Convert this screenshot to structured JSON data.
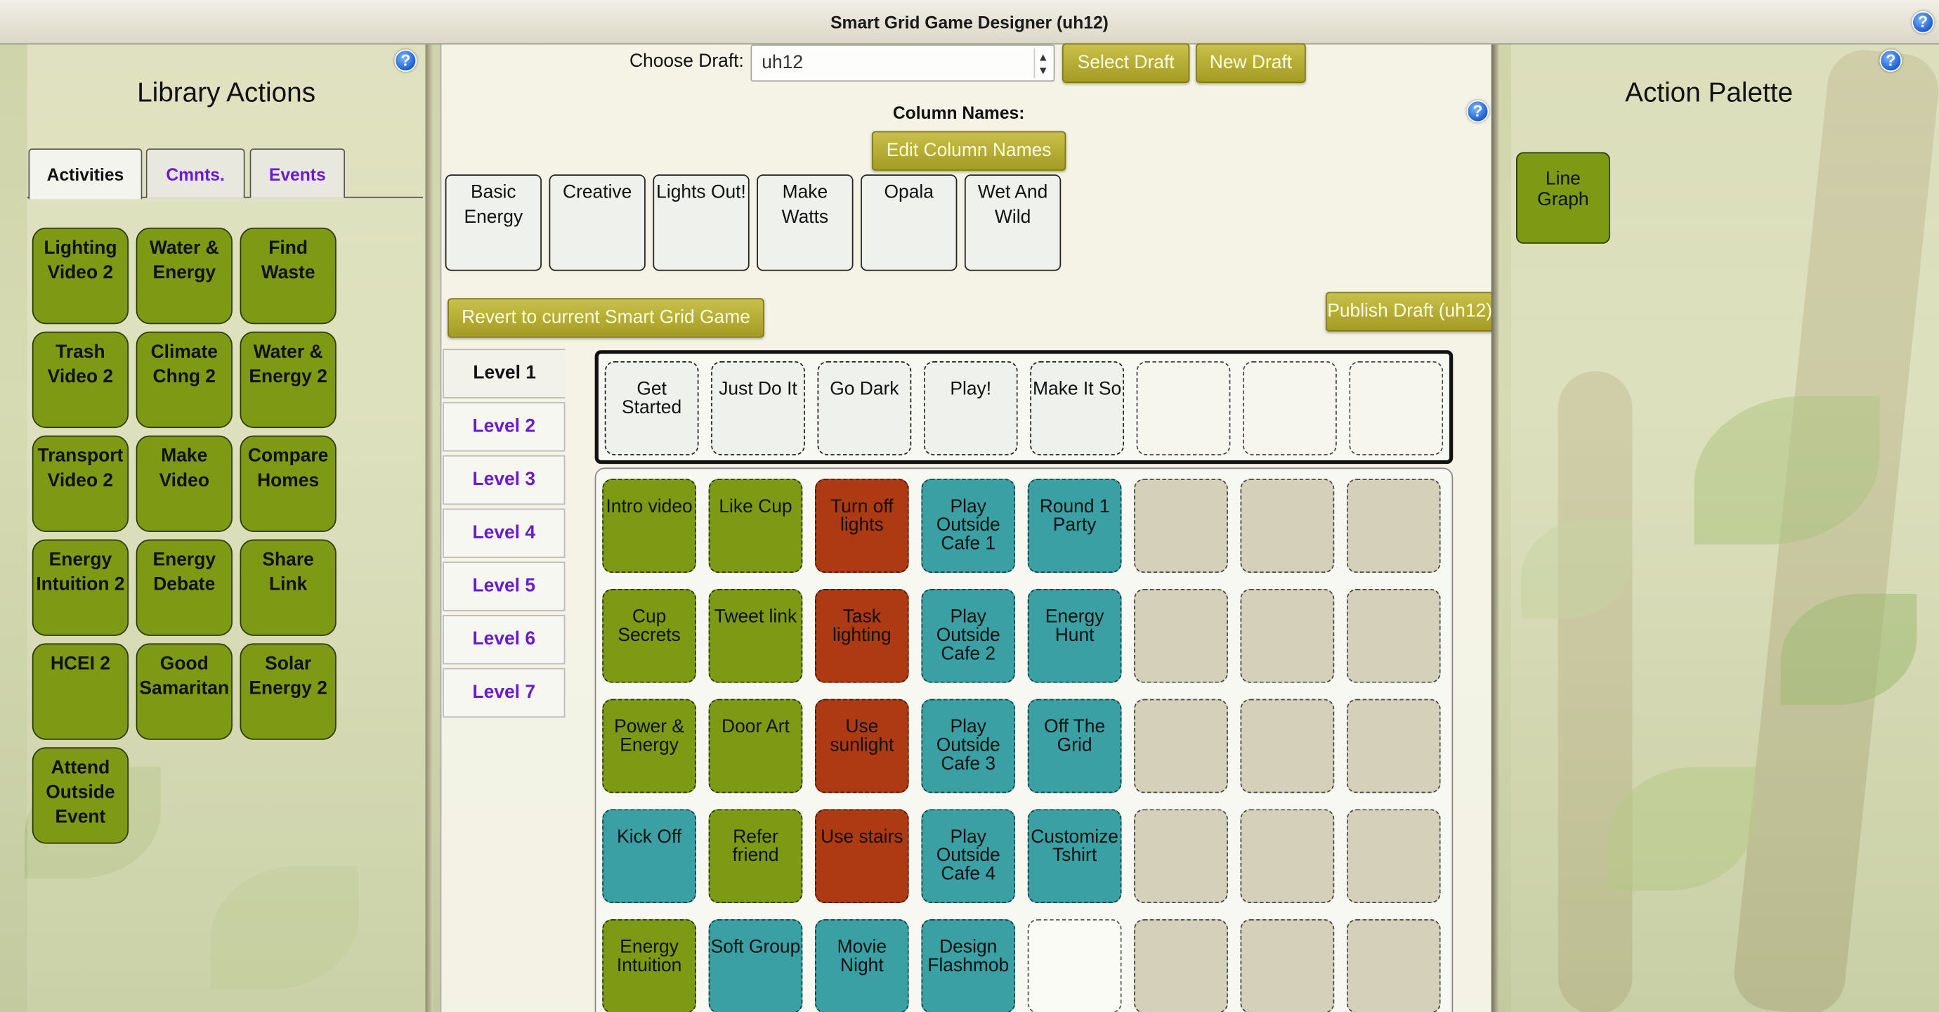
{
  "window": {
    "title": "Smart Grid Game Designer (uh12)"
  },
  "help_icon_glyph": "?",
  "library": {
    "title": "Library Actions",
    "tabs": [
      "Activities",
      "Cmnts.",
      "Events"
    ],
    "buttons": [
      "Lighting Video 2",
      "Water & Energy",
      "Find Waste",
      "Trash Video 2",
      "Climate Chng 2",
      "Water & Energy 2",
      "Transport Video 2",
      "Make Video",
      "Compare Homes",
      "Energy Intuition 2",
      "Energy Debate",
      "Share Link",
      "HCEI 2",
      "Good Samaritan",
      "Solar Energy 2",
      "Attend Outside Event"
    ]
  },
  "designer": {
    "choose_draft_label": "Choose Draft:",
    "draft_value": "uh12",
    "select_draft_label": "Select Draft",
    "new_draft_label": "New Draft",
    "column_names_label": "Column Names:",
    "edit_column_names_label": "Edit Column Names",
    "columns": [
      "Basic Energy",
      "Creative",
      "Lights Out!",
      "Make Watts",
      "Opala",
      "Wet And Wild"
    ],
    "revert_label": "Revert to current Smart Grid Game",
    "publish_label": "Publish Draft (uh12)",
    "levels": [
      "Level 1",
      "Level 2",
      "Level 3",
      "Level 4",
      "Level 5",
      "Level 6",
      "Level 7"
    ],
    "level_columns": [
      "Get Started",
      "Just Do It",
      "Go Dark",
      "Play!",
      "Make It So"
    ],
    "grid": [
      [
        {
          "label": "Intro video",
          "color": "green"
        },
        {
          "label": "Like Cup",
          "color": "green"
        },
        {
          "label": "Turn off lights",
          "color": "rust"
        },
        {
          "label": "Play Outside Cafe 1",
          "color": "teal"
        },
        {
          "label": "Round 1 Party",
          "color": "teal"
        }
      ],
      [
        {
          "label": "Cup Secrets",
          "color": "green"
        },
        {
          "label": "Tweet link",
          "color": "green"
        },
        {
          "label": "Task lighting",
          "color": "rust"
        },
        {
          "label": "Play Outside Cafe 2",
          "color": "teal"
        },
        {
          "label": "Energy Hunt",
          "color": "teal"
        }
      ],
      [
        {
          "label": "Power & Energy",
          "color": "green"
        },
        {
          "label": "Door Art",
          "color": "green"
        },
        {
          "label": "Use sunlight",
          "color": "rust"
        },
        {
          "label": "Play Outside Cafe 3",
          "color": "teal"
        },
        {
          "label": "Off The Grid",
          "color": "teal"
        }
      ],
      [
        {
          "label": "Kick Off",
          "color": "teal"
        },
        {
          "label": "Refer friend",
          "color": "green"
        },
        {
          "label": "Use stairs",
          "color": "rust"
        },
        {
          "label": "Play Outside Cafe 4",
          "color": "teal"
        },
        {
          "label": "Customize Tshirt",
          "color": "teal"
        }
      ],
      [
        {
          "label": "Energy Intuition",
          "color": "green"
        },
        {
          "label": "Soft Group",
          "color": "teal"
        },
        {
          "label": "Movie Night",
          "color": "teal"
        },
        {
          "label": "Design Flashmob",
          "color": "teal"
        }
      ]
    ]
  },
  "palette": {
    "title": "Action Palette",
    "buttons": [
      "Line Graph"
    ]
  },
  "colors": {
    "green": "#7e9a14",
    "teal": "#3aa0a3",
    "rust": "#ad3a13",
    "gold_button": "#b3ab33",
    "tab_link": "#6a1bd1"
  }
}
